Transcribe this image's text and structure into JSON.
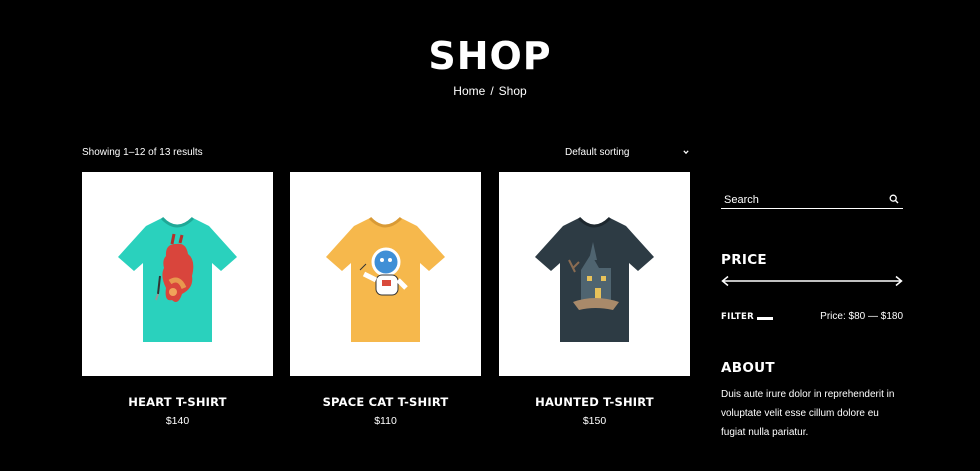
{
  "header": {
    "title": "SHOP",
    "breadcrumb": {
      "home": "Home",
      "separator": "/",
      "current": "Shop"
    }
  },
  "toolbar": {
    "result_count": "Showing 1–12 of 13 results",
    "sorting_label": "Default sorting"
  },
  "products": [
    {
      "name": "HEART T-SHIRT",
      "price": "$140",
      "shirt_color": "#2ad1bd",
      "print": "heart"
    },
    {
      "name": "SPACE CAT T-SHIRT",
      "price": "$110",
      "shirt_color": "#f6b84c",
      "print": "astronaut"
    },
    {
      "name": "HAUNTED T-SHIRT",
      "price": "$150",
      "shirt_color": "#2d3b44",
      "print": "house"
    }
  ],
  "sidebar": {
    "search_placeholder": "Search",
    "price_title": "PRICE",
    "filter_label": "FILTER",
    "price_range": "Price: $80 — $180",
    "about_title": "ABOUT",
    "about_text": "Duis aute irure dolor in reprehenderit in voluptate velit esse cillum dolore eu fugiat nulla pariatur."
  },
  "colors": {
    "background": "#000000",
    "text": "#ffffff",
    "card": "#ffffff"
  }
}
